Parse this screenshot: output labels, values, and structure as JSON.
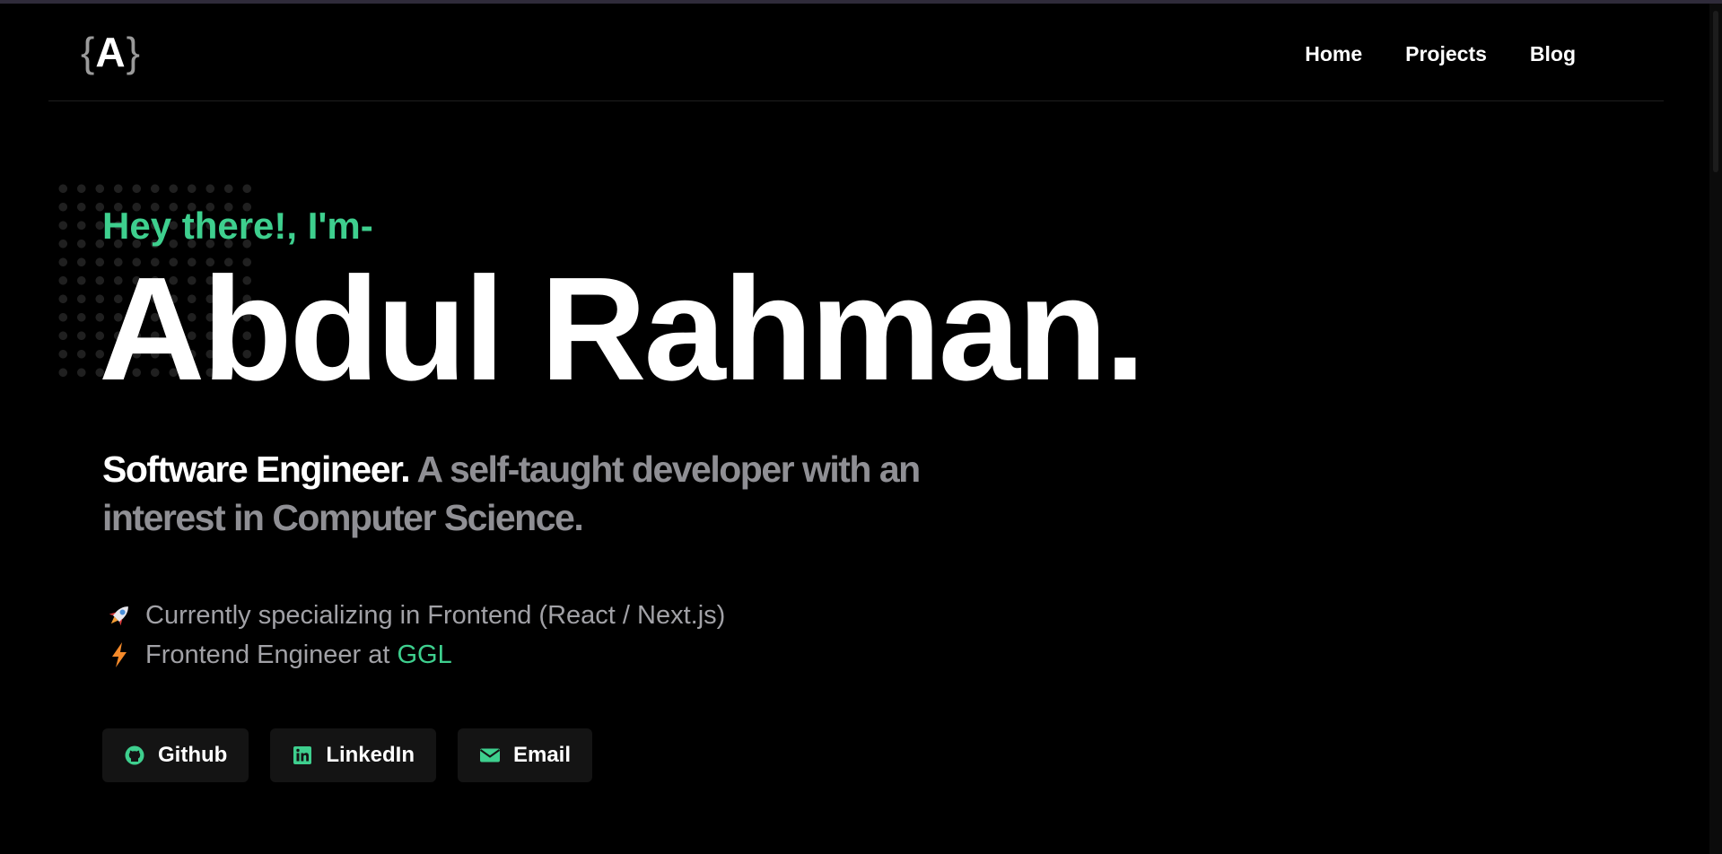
{
  "header": {
    "logo": {
      "open": "{",
      "letter": "A",
      "close": "}"
    },
    "nav": [
      {
        "label": "Home"
      },
      {
        "label": "Projects"
      },
      {
        "label": "Blog"
      }
    ]
  },
  "hero": {
    "greeting": "Hey there!, I'm-",
    "name": "Abdul Rahman.",
    "tagline_role": "Software Engineer.",
    "tagline_rest": " A self-taught developer with an interest in Computer Science."
  },
  "facts": [
    {
      "icon": "rocket-icon",
      "text": "Currently specializing in Frontend (React / Next.js)"
    },
    {
      "icon": "lightning-icon",
      "text": "Frontend Engineer at",
      "highlight": "GGL"
    }
  ],
  "socials": [
    {
      "icon": "github-icon",
      "label": "Github"
    },
    {
      "icon": "linkedin-icon",
      "label": "LinkedIn"
    },
    {
      "icon": "email-icon",
      "label": "Email"
    }
  ],
  "colors": {
    "background": "#000000",
    "accent": "#3ecf8e",
    "muted_text": "#a1a1a6",
    "button_bg": "#141414"
  }
}
